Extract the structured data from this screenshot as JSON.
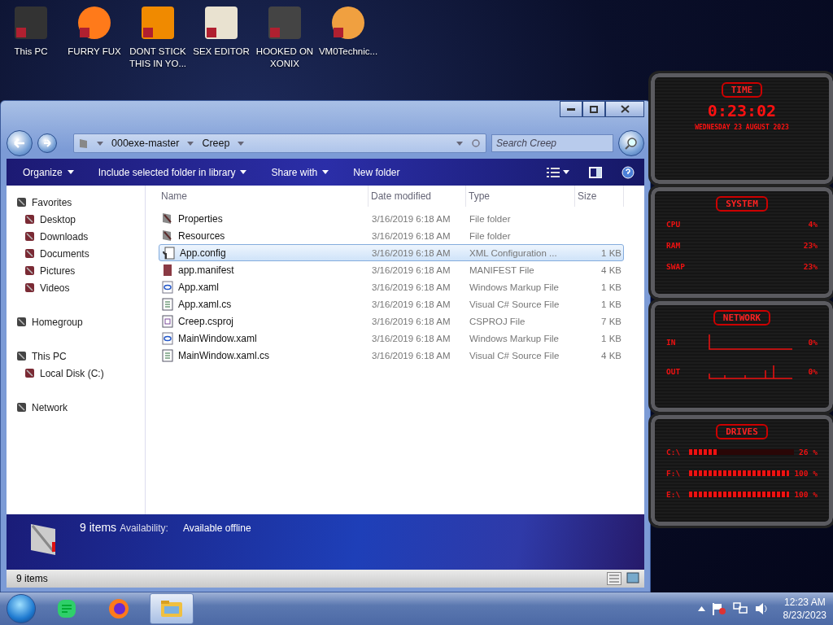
{
  "desktop_icons": [
    {
      "label": "This PC"
    },
    {
      "label": "FURRY FUX"
    },
    {
      "label": "DONT STICK THIS IN YO..."
    },
    {
      "label": "SEX EDITOR"
    },
    {
      "label": "HOOKED ON XONIX"
    },
    {
      "label": "VM0Technic..."
    }
  ],
  "window": {
    "address": [
      "000exe-master",
      "Creep"
    ],
    "search": {
      "placeholder": "Search Creep"
    },
    "toolbar": [
      {
        "label": "Organize",
        "dropdown": true
      },
      {
        "label": "Include selected folder in library",
        "dropdown": true
      },
      {
        "label": "Share with",
        "dropdown": true
      },
      {
        "label": "New folder",
        "dropdown": false
      }
    ],
    "sidebar": {
      "items": [
        {
          "label": "Favorites",
          "children": [
            {
              "label": "Desktop"
            },
            {
              "label": "Downloads"
            },
            {
              "label": "Documents"
            },
            {
              "label": "Pictures"
            },
            {
              "label": "Videos"
            }
          ]
        },
        {
          "label": "Homegroup"
        },
        {
          "label": "This PC",
          "children": [
            {
              "label": "Local Disk (C:)"
            }
          ]
        },
        {
          "label": "Network"
        }
      ]
    },
    "table": {
      "columns": [
        "Name",
        "Date modified",
        "Type",
        "Size"
      ],
      "rows": [
        {
          "kind": "folder",
          "name": "Properties",
          "date": "3/16/2019 6:18 AM",
          "type": "File folder",
          "size": "",
          "selected": false
        },
        {
          "kind": "folder",
          "name": "Resources",
          "date": "3/16/2019 6:18 AM",
          "type": "File folder",
          "size": "",
          "selected": false
        },
        {
          "kind": "config",
          "name": "App.config",
          "date": "3/16/2019 6:18 AM",
          "type": "XML Configuration ...",
          "size": "1 KB",
          "selected": true
        },
        {
          "kind": "manifest",
          "name": "app.manifest",
          "date": "3/16/2019 6:18 AM",
          "type": "MANIFEST File",
          "size": "4 KB",
          "selected": false
        },
        {
          "kind": "xaml",
          "name": "App.xaml",
          "date": "3/16/2019 6:18 AM",
          "type": "Windows Markup File",
          "size": "1 KB",
          "selected": false
        },
        {
          "kind": "cs",
          "name": "App.xaml.cs",
          "date": "3/16/2019 6:18 AM",
          "type": "Visual C# Source File",
          "size": "1 KB",
          "selected": false
        },
        {
          "kind": "csproj",
          "name": "Creep.csproj",
          "date": "3/16/2019 6:18 AM",
          "type": "CSPROJ File",
          "size": "7 KB",
          "selected": false
        },
        {
          "kind": "xaml",
          "name": "MainWindow.xaml",
          "date": "3/16/2019 6:18 AM",
          "type": "Windows Markup File",
          "size": "1 KB",
          "selected": false
        },
        {
          "kind": "cs",
          "name": "MainWindow.xaml.cs",
          "date": "3/16/2019 6:18 AM",
          "type": "Visual C# Source File",
          "size": "4 KB",
          "selected": false
        }
      ]
    },
    "details": {
      "count": "9 items",
      "availability_label": "Availability:",
      "availability": "Available offline"
    },
    "status_bar": "9 items"
  },
  "gadgets": {
    "time": {
      "title": "TIME",
      "clock": "0:23:02",
      "date": "WEDNESDAY 23 AUGUST 2023"
    },
    "system": {
      "title": "SYSTEM",
      "rows": [
        {
          "label": "CPU",
          "value": "4%"
        },
        {
          "label": "RAM",
          "value": "23%"
        },
        {
          "label": "SWAP",
          "value": "23%"
        }
      ]
    },
    "network": {
      "title": "NETWORK",
      "rows": [
        {
          "label": "IN",
          "value": "0%"
        },
        {
          "label": "OUT",
          "value": "0%"
        }
      ]
    },
    "drives": {
      "title": "DRIVES",
      "rows": [
        {
          "label": "C:\\",
          "value": "26 %",
          "level": 0.26
        },
        {
          "label": "F:\\",
          "value": "100 %",
          "level": 1
        },
        {
          "label": "E:\\",
          "value": "100 %",
          "level": 1
        }
      ]
    }
  },
  "taskbar": {
    "clock": "12:23 AM",
    "date": "8/23/2023"
  }
}
